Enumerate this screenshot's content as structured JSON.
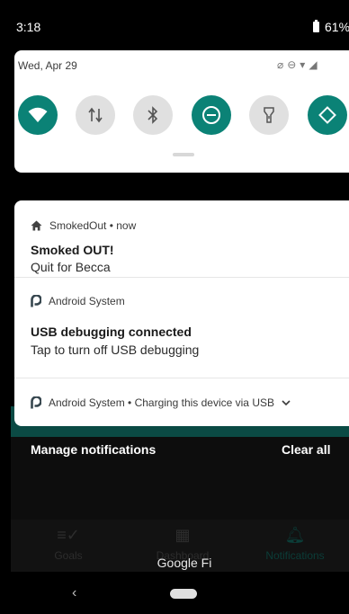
{
  "status_bar": {
    "time": "3:18",
    "battery": "61%"
  },
  "quick_settings": {
    "date": "Wed, Apr 29",
    "tiles": [
      {
        "name": "wifi",
        "state": "on"
      },
      {
        "name": "mobile-data",
        "state": "off"
      },
      {
        "name": "bluetooth",
        "state": "off"
      },
      {
        "name": "do-not-disturb",
        "state": "on"
      },
      {
        "name": "flashlight",
        "state": "off"
      },
      {
        "name": "auto-rotate",
        "state": "on"
      }
    ]
  },
  "notifications": [
    {
      "app": "SmokedOut",
      "meta": "now",
      "title": "Smoked OUT!",
      "text": "Quit for Becca",
      "icon": "home-icon"
    },
    {
      "app": "Android System",
      "title": "USB debugging connected",
      "text": "Tap to turn off USB debugging",
      "icon": "android-p-icon"
    },
    {
      "app": "Android System",
      "meta": "Charging this device via USB",
      "icon": "android-p-icon"
    }
  ],
  "actions": {
    "manage": "Manage notifications",
    "clear_all": "Clear all"
  },
  "background_app": {
    "tabs": [
      {
        "label": "Goals",
        "icon": "list-check-icon"
      },
      {
        "label": "Dashboard",
        "icon": "grid-icon"
      },
      {
        "label": "Notifications",
        "icon": "bell-icon"
      }
    ]
  },
  "system_label": "Google Fi",
  "colors": {
    "accent": "#0b8276",
    "panel": "#ffffff"
  }
}
